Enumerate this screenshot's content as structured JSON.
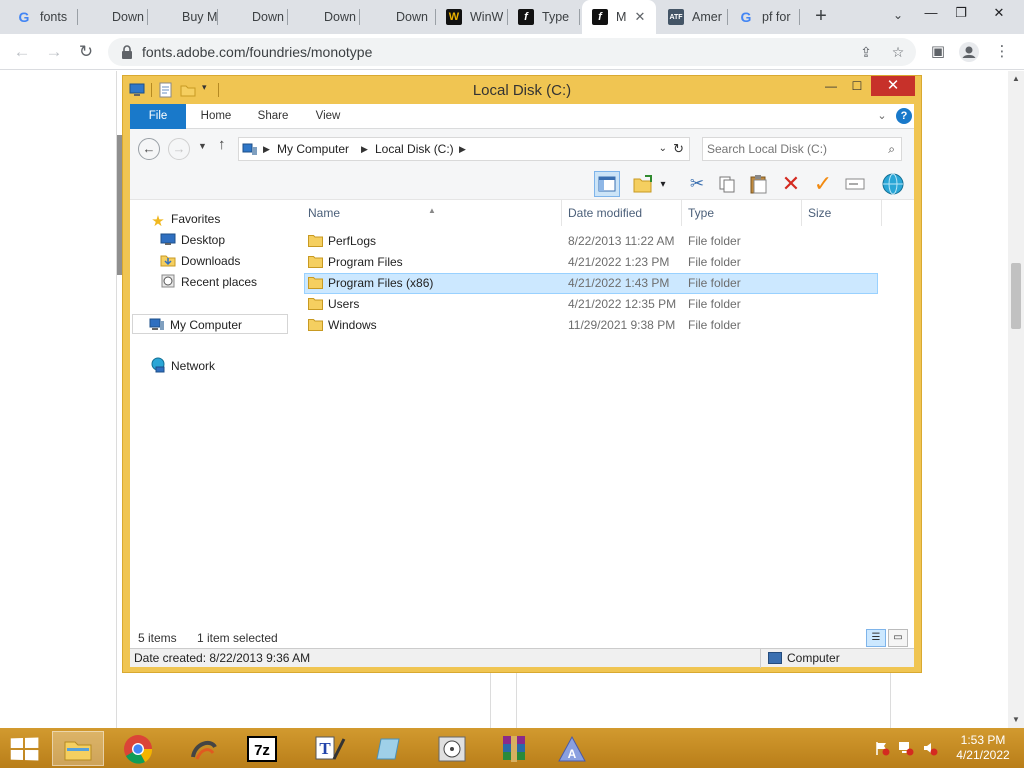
{
  "browser": {
    "tabs": [
      {
        "label": "fonts",
        "favicon": "google-icon"
      },
      {
        "label": "Down",
        "favicon": "microsoft-icon"
      },
      {
        "label": "Buy M",
        "favicon": "microsoft-icon"
      },
      {
        "label": "Down",
        "favicon": "microsoft-icon"
      },
      {
        "label": "Down",
        "favicon": "microsoft-icon"
      },
      {
        "label": "Down",
        "favicon": "microsoft-icon"
      },
      {
        "label": "WinW",
        "favicon": "w-logo-icon"
      },
      {
        "label": "Type",
        "favicon": "f-logo-icon"
      },
      {
        "label": "M",
        "favicon": "f-logo-icon",
        "active": true
      },
      {
        "label": "Amer",
        "favicon": "atf-icon"
      },
      {
        "label": "pf for",
        "favicon": "google-icon"
      }
    ],
    "atf_badge": "ATF",
    "url": "fonts.adobe.com/foundries/monotype"
  },
  "explorer": {
    "title": "Local Disk (C:)",
    "ribbon_tabs": [
      "File",
      "Home",
      "Share",
      "View"
    ],
    "breadcrumb": [
      "My Computer",
      "Local Disk (C:)"
    ],
    "search_placeholder": "Search Local Disk (C:)",
    "nav": {
      "favorites": "Favorites",
      "desktop": "Desktop",
      "downloads": "Downloads",
      "recent": "Recent places",
      "computer": "My Computer",
      "network": "Network"
    },
    "columns": {
      "name": "Name",
      "date": "Date modified",
      "type": "Type",
      "size": "Size"
    },
    "files": [
      {
        "name": "PerfLogs",
        "date": "8/22/2013 11:22 AM",
        "type": "File folder"
      },
      {
        "name": "Program Files",
        "date": "4/21/2022 1:23 PM",
        "type": "File folder"
      },
      {
        "name": "Program Files (x86)",
        "date": "4/21/2022 1:43 PM",
        "type": "File folder",
        "selected": true
      },
      {
        "name": "Users",
        "date": "4/21/2022 12:35 PM",
        "type": "File folder"
      },
      {
        "name": "Windows",
        "date": "11/29/2021 9:38 PM",
        "type": "File folder"
      }
    ],
    "status": {
      "items": "5 items",
      "selected": "1 item selected"
    },
    "details": {
      "created": "Date created: 8/22/2013 9:36 AM",
      "computer": "Computer"
    }
  },
  "taskbar": {
    "time": "1:53 PM",
    "date": "4/21/2022",
    "sevenzip_label": "7z"
  },
  "colors": {
    "explorer_frame": "#f0c552",
    "ribbon_file": "#1979ca",
    "selection": "#cce8ff",
    "taskbar": "#c98f24"
  }
}
